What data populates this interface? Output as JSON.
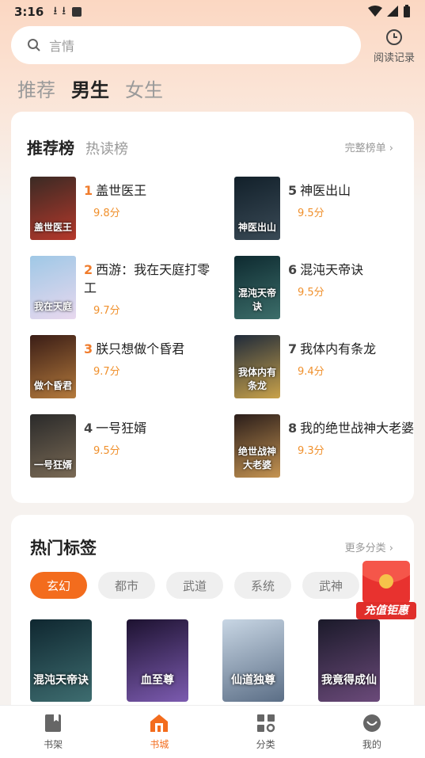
{
  "status_bar": {
    "time": "3:16"
  },
  "search": {
    "placeholder": "言情"
  },
  "history": {
    "label": "阅读记录"
  },
  "tabs": [
    {
      "label": "推荐",
      "active": false
    },
    {
      "label": "男生",
      "active": true
    },
    {
      "label": "女生",
      "active": false
    }
  ],
  "ranking": {
    "tab_active": "推荐榜",
    "tab_other": "热读榜",
    "more_label": "完整榜单",
    "books": [
      {
        "rank": "1",
        "title": "盖世医王",
        "score": "9.8分",
        "cover_text": "盖世医王",
        "cover_colors": [
          "#3a2a24",
          "#b5382b"
        ]
      },
      {
        "rank": "2",
        "title": "西游：我在天庭打零工",
        "score": "9.7分",
        "cover_text": "我在天庭",
        "cover_colors": [
          "#9fc8e6",
          "#e8d8ee"
        ]
      },
      {
        "rank": "3",
        "title": "朕只想做个昏君",
        "score": "9.7分",
        "cover_text": "做个昏君",
        "cover_colors": [
          "#3a1d16",
          "#b47a3c"
        ]
      },
      {
        "rank": "4",
        "title": "一号狂婿",
        "score": "9.5分",
        "cover_text": "一号狂婿",
        "cover_colors": [
          "#2a2a2a",
          "#7a6a55"
        ]
      },
      {
        "rank": "5",
        "title": "神医出山",
        "score": "9.5分",
        "cover_text": "神医出山",
        "cover_colors": [
          "#12202a",
          "#3a4a56"
        ]
      },
      {
        "rank": "6",
        "title": "混沌天帝诀",
        "score": "9.5分",
        "cover_text": "混沌天帝诀",
        "cover_colors": [
          "#0e2a30",
          "#3c6e6a"
        ]
      },
      {
        "rank": "7",
        "title": "我体内有条龙",
        "score": "9.4分",
        "cover_text": "我体内有条龙",
        "cover_colors": [
          "#1f2a3a",
          "#c9a24a"
        ]
      },
      {
        "rank": "8",
        "title": "我的绝世战神大老婆",
        "score": "9.3分",
        "cover_text": "绝世战神大老婆",
        "cover_colors": [
          "#2a1d1a",
          "#c59452"
        ]
      }
    ]
  },
  "hot_tags": {
    "title": "热门标签",
    "more_label": "更多分类",
    "chips": [
      "玄幻",
      "都市",
      "武道",
      "系统",
      "武神"
    ],
    "covers": [
      {
        "text": "混沌天帝诀",
        "colors": [
          "#0f2730",
          "#3e6d70"
        ]
      },
      {
        "text": "血至尊",
        "colors": [
          "#1d1230",
          "#7c5bb0"
        ]
      },
      {
        "text": "仙道独尊",
        "colors": [
          "#c8d6e4",
          "#5b6e86"
        ]
      },
      {
        "text": "我竟得成仙",
        "colors": [
          "#1b1a2a",
          "#6b4a7a"
        ]
      }
    ]
  },
  "promo": {
    "label": "充值钜惠"
  },
  "bottom_nav": [
    {
      "label": "书架",
      "icon": "bookshelf-icon",
      "active": false
    },
    {
      "label": "书城",
      "icon": "bookstore-icon",
      "active": true
    },
    {
      "label": "分类",
      "icon": "category-icon",
      "active": false
    },
    {
      "label": "我的",
      "icon": "profile-icon",
      "active": false
    }
  ],
  "colors": {
    "accent": "#f36c1d",
    "score": "#f0902c"
  }
}
